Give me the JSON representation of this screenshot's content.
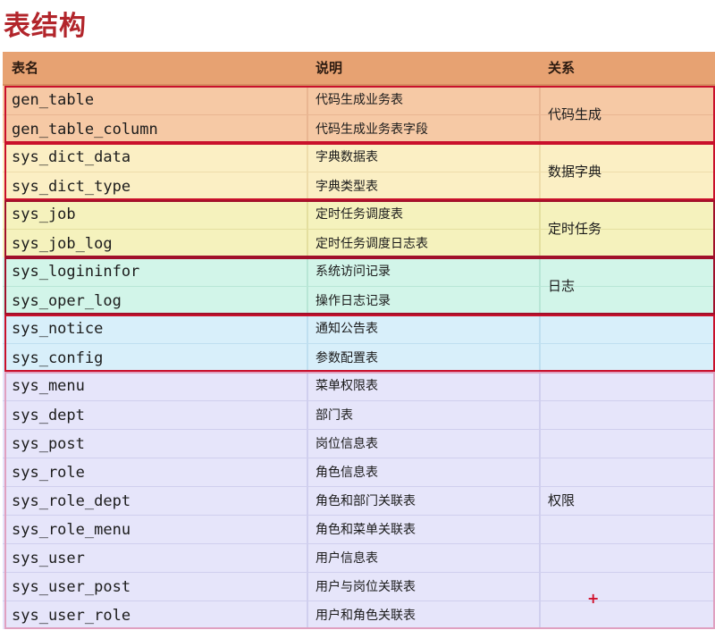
{
  "title": "表结构",
  "header": {
    "col_name": "表名",
    "col_desc": "说明",
    "col_rel": "关系"
  },
  "groups": [
    {
      "relation": "代码生成",
      "bg": "#f6c9a5",
      "divider": "#e9b692",
      "border": "#c9102b",
      "framed": true,
      "rows": [
        {
          "name": "gen_table",
          "desc": "代码生成业务表"
        },
        {
          "name": "gen_table_column",
          "desc": "代码生成业务表字段"
        }
      ]
    },
    {
      "relation": "数据字典",
      "bg": "#fbefc4",
      "divider": "#eedcaa",
      "border": "#c9102b",
      "framed": true,
      "rows": [
        {
          "name": "sys_dict_data",
          "desc": "字典数据表"
        },
        {
          "name": "sys_dict_type",
          "desc": "字典类型表"
        }
      ]
    },
    {
      "relation": "定时任务",
      "bg": "#f5f2bd",
      "divider": "#e4df9f",
      "border": "#a0102b",
      "framed": true,
      "rows": [
        {
          "name": "sys_job",
          "desc": "定时任务调度表"
        },
        {
          "name": "sys_job_log",
          "desc": "定时任务调度日志表"
        }
      ]
    },
    {
      "relation": "日志",
      "bg": "#d2f5e9",
      "divider": "#b8e6d6",
      "border": "#a0102b",
      "framed": true,
      "rows": [
        {
          "name": "sys_logininfor",
          "desc": "系统访问记录"
        },
        {
          "name": "sys_oper_log",
          "desc": "操作日志记录"
        }
      ]
    },
    {
      "relation": "",
      "bg": "#d8effa",
      "divider": "#bfdff0",
      "border": "#c9102b",
      "framed": true,
      "rows": [
        {
          "name": "sys_notice",
          "desc": "通知公告表"
        },
        {
          "name": "sys_config",
          "desc": "参数配置表"
        }
      ]
    },
    {
      "relation": "权限",
      "bg": "#e6e5fa",
      "divider": "#d0cfee",
      "border": "#e0a0c0",
      "framed": true,
      "rows": [
        {
          "name": "sys_menu",
          "desc": "菜单权限表"
        },
        {
          "name": "sys_dept",
          "desc": "部门表"
        },
        {
          "name": "sys_post",
          "desc": "岗位信息表"
        },
        {
          "name": "sys_role",
          "desc": "角色信息表"
        },
        {
          "name": "sys_role_dept",
          "desc": "角色和部门关联表"
        },
        {
          "name": "sys_role_menu",
          "desc": "角色和菜单关联表"
        },
        {
          "name": "sys_user",
          "desc": "用户信息表"
        },
        {
          "name": "sys_user_post",
          "desc": "用户与岗位关联表"
        },
        {
          "name": "sys_user_role",
          "desc": "用户和角色关联表"
        }
      ]
    }
  ],
  "marker": "+"
}
